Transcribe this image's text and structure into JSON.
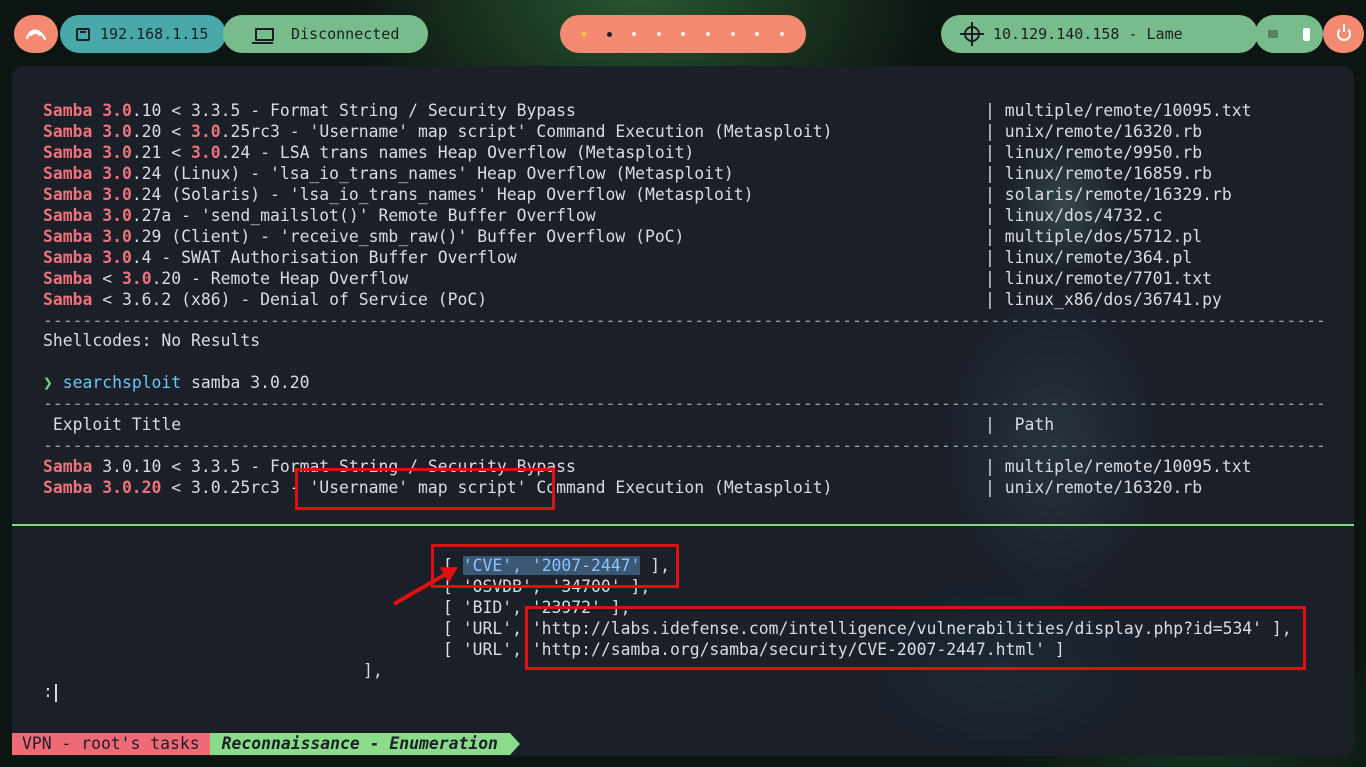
{
  "topbar": {
    "ip": "192.168.1.15",
    "vpn_status": "Disconnected",
    "target": "10.129.140.158 - Lame",
    "workspace_dots": 9
  },
  "output": {
    "rows": [
      {
        "hl": "Samba 3.0",
        "rest_pre": ".10 < 3.3.5 - Format String / Security Bypass",
        "hl2": "",
        "rest_post": "",
        "path": "| multiple/remote/10095.txt"
      },
      {
        "hl": "Samba 3.0",
        "rest_pre": ".20 < ",
        "hl2": "3.0",
        "rest_post": ".25rc3 - 'Username' map script' Command Execution (Metasploit)",
        "path": "| unix/remote/16320.rb"
      },
      {
        "hl": "Samba 3.0",
        "rest_pre": ".21 < ",
        "hl2": "3.0",
        "rest_post": ".24 - LSA trans names Heap Overflow (Metasploit)",
        "path": "| linux/remote/9950.rb"
      },
      {
        "hl": "Samba 3.0",
        "rest_pre": ".24 (Linux) - 'lsa_io_trans_names' Heap Overflow (Metasploit)",
        "hl2": "",
        "rest_post": "",
        "path": "| linux/remote/16859.rb"
      },
      {
        "hl": "Samba 3.0",
        "rest_pre": ".24 (Solaris) - 'lsa_io_trans_names' Heap Overflow (Metasploit)",
        "hl2": "",
        "rest_post": "",
        "path": "| solaris/remote/16329.rb"
      },
      {
        "hl": "Samba 3.0",
        "rest_pre": ".27a - 'send_mailslot()' Remote Buffer Overflow",
        "hl2": "",
        "rest_post": "",
        "path": "| linux/dos/4732.c"
      },
      {
        "hl": "Samba 3.0",
        "rest_pre": ".29 (Client) - 'receive_smb_raw()' Buffer Overflow (PoC)",
        "hl2": "",
        "rest_post": "",
        "path": "| multiple/dos/5712.pl"
      },
      {
        "hl": "Samba 3.0",
        "rest_pre": ".4 - SWAT Authorisation Buffer Overflow",
        "hl2": "",
        "rest_post": "",
        "path": "| linux/remote/364.pl"
      },
      {
        "hl": "Samba",
        "rest_pre": " < ",
        "hl2": "3.0",
        "rest_post": ".20 - Remote Heap Overflow",
        "path": "| linux/remote/7701.txt"
      },
      {
        "hl": "Samba",
        "rest_pre": " < 3.6.2 (x86) - Denial of Service (PoC)",
        "hl2": "",
        "rest_post": "",
        "path": "| linux_x86/dos/36741.py"
      }
    ],
    "shellcodes": "Shellcodes: No Results",
    "prompt_symbol": "❯",
    "command": "searchsploit",
    "command_args": " samba 3.0.20",
    "header_title": " Exploit Title",
    "header_path": "|  Path",
    "rows2": [
      {
        "hl": "Samba",
        "rest": " 3.0.10 < 3.3.5 - Format String / Security Bypass",
        "path": "| multiple/remote/10095.txt"
      },
      {
        "hl": "Samba 3.0.20",
        "rest": " < 3.0.25rc3 - 'Username' map script' Command Execution (Metasploit)",
        "path": "| unix/remote/16320.rb"
      }
    ]
  },
  "pager": {
    "cve_open": "[ ",
    "cve_text": "'CVE', '2007-2447'",
    "cve_close": " ],",
    "osvdb": "[ 'OSVDB', '34700' ],",
    "bid": "[ 'BID', '23972' ],",
    "url1_pre": "[ 'URL', ",
    "url1": "'http://labs.idefense.com/intelligence/vulnerabilities/display.php?id=534'",
    "url1_post": " ],",
    "url2_pre": "[ 'URL', ",
    "url2": "'http://samba.org/samba/security/CVE-2007-2447.html'",
    "url2_post": " ]",
    "closing": "],",
    "pager_prompt": ":"
  },
  "statusbar": {
    "session": "VPN - root's tasks",
    "task": "Reconnaissance - Enumeration"
  }
}
